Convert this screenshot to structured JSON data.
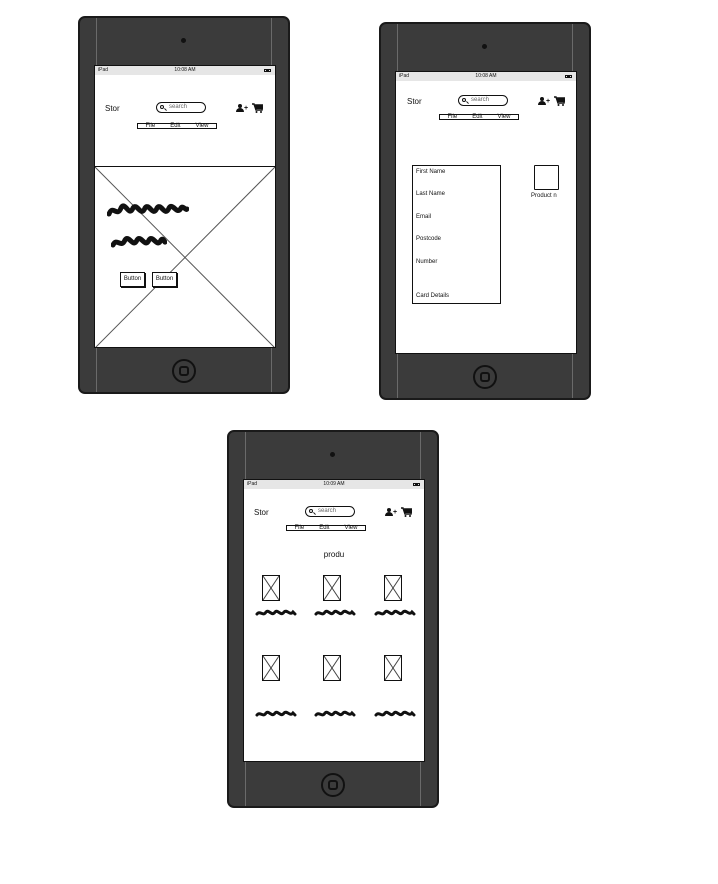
{
  "shared": {
    "status_carrier": "iPad",
    "brand": "Stor",
    "search_placeholder": "search",
    "menu": [
      "File",
      "Edit",
      "View"
    ]
  },
  "screen1": {
    "time": "10:08 AM",
    "buttons": [
      "Button",
      "Button"
    ]
  },
  "screen2": {
    "time": "10:08 AM",
    "form_fields": [
      "First Name",
      "Last Name",
      "Email",
      "Postcode",
      "Number",
      "Card Details"
    ],
    "product_label": "Product n"
  },
  "screen3": {
    "time": "10:09 AM",
    "heading": "produ"
  }
}
